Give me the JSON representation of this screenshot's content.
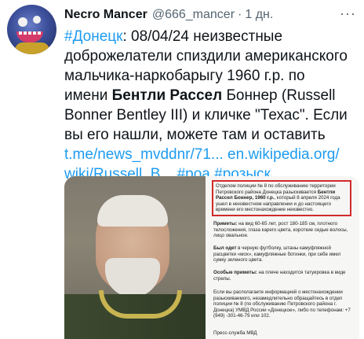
{
  "user": {
    "display_name": "Necro Mancer",
    "handle": "@666_mancer",
    "separator": "·",
    "time": "1 дн.",
    "more": "···"
  },
  "tweet": {
    "l1_tag": "#Донецк",
    "l1_text": ": 08/04/24 неизвестные",
    "l2": "доброжелатели спиздили американского",
    "l3": "мальчика-наркобарыгу 1960 г.р. по",
    "l4_pre": "имени ",
    "l4_bold": "Бентли Рассел",
    "l4_post": " Боннер (Russell",
    "l5": "Bonner Bentley III) и кличке \"Техас\". Если",
    "l6": "вы его нашли, можете там и оставить",
    "l7_link1": "t.me/news_mvddnr/71...",
    "l7_link2": "en.wikipedia.org/",
    "l8_link": "wiki/Russell_B...",
    "l8_tag1": "#роа",
    "l8_tag2": "#розыск"
  },
  "document": {
    "box_a": "Отделом полиции № 8 по обслуживанию территории Петровского района Донецка разыскивается ",
    "box_b": "Бентли Рассел Боннер, 1960 г.р.",
    "box_c": ", который 8 апреля 2024 года ушел в неизвестном направлении и до настоящего времени его местонахождение неизвестно.",
    "signs_label": "Приметы:",
    "signs_text": " на вид 60-65 лет, рост 180-185 см, плотного телосложения, глаза карего цвета, короткие седые волосы, лицо овальное.",
    "dress_label": "Был одет",
    "dress_text": " в черную футболку, штаны камуфляжной расцветки «мох», камуфляжные ботинки, при себе имел сумку зеленого цвета.",
    "special_label": "Особые приметы:",
    "special_text": " на плече находится татуировка в виде стрелы.",
    "contact": "Если вы располагаете информацией о местонахождении разыскиваемого, незамедлительно обращайтесь в отдел полиции № 8 (по обслуживанию Петровского района г. Донецка) УМВД России «Донецкое», либо по телефонам: +7 (949) -301-46-79 или 102.",
    "footer": "Пресс-служба МВД"
  },
  "colors": {
    "link": "#1d9bf0",
    "text": "#0f1419",
    "muted": "#536471",
    "highlight_border": "#d12b2b"
  }
}
